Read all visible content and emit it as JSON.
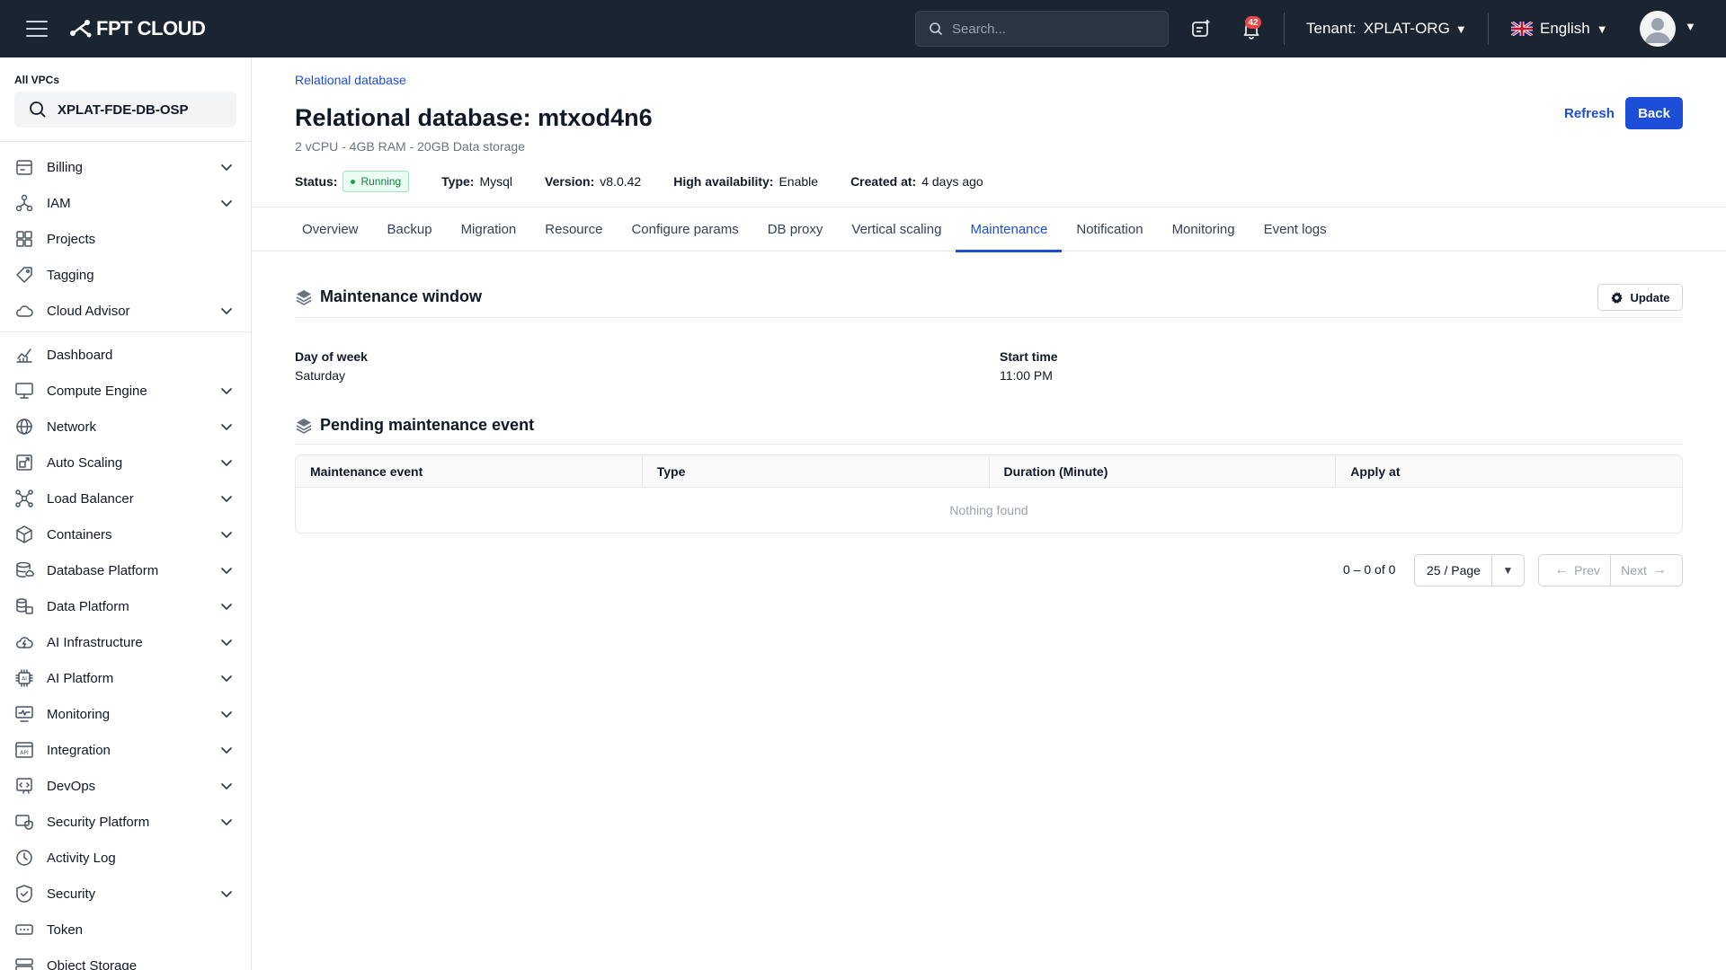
{
  "header": {
    "brand": "FPT CLOUD",
    "search_placeholder": "Search...",
    "notification_count": "42",
    "tenant_label": "Tenant:",
    "tenant_value": "XPLAT-ORG",
    "language": "English"
  },
  "sidebar": {
    "vpc_label": "All VPCs",
    "vpc_value": "XPLAT-FDE-DB-OSP",
    "items": [
      {
        "label": "Billing",
        "icon": "billing-icon",
        "expandable": true
      },
      {
        "label": "IAM",
        "icon": "iam-icon",
        "expandable": true
      },
      {
        "label": "Projects",
        "icon": "projects-icon",
        "expandable": false
      },
      {
        "label": "Tagging",
        "icon": "tag-icon",
        "expandable": false
      },
      {
        "label": "Cloud Advisor",
        "icon": "cloud-icon",
        "expandable": true
      },
      {
        "label": "Dashboard",
        "icon": "dashboard-icon",
        "expandable": false
      },
      {
        "label": "Compute Engine",
        "icon": "monitor-icon",
        "expandable": true
      },
      {
        "label": "Network",
        "icon": "globe-icon",
        "expandable": true
      },
      {
        "label": "Auto Scaling",
        "icon": "scaling-icon",
        "expandable": true
      },
      {
        "label": "Load Balancer",
        "icon": "load-balancer-icon",
        "expandable": true
      },
      {
        "label": "Containers",
        "icon": "box-icon",
        "expandable": true
      },
      {
        "label": "Database Platform",
        "icon": "database-icon",
        "expandable": true
      },
      {
        "label": "Data Platform",
        "icon": "data-platform-icon",
        "expandable": true
      },
      {
        "label": "AI Infrastructure",
        "icon": "ai-infra-icon",
        "expandable": true
      },
      {
        "label": "AI Platform",
        "icon": "ai-chip-icon",
        "expandable": true
      },
      {
        "label": "Monitoring",
        "icon": "monitoring-icon",
        "expandable": true
      },
      {
        "label": "Integration",
        "icon": "api-icon",
        "expandable": true
      },
      {
        "label": "DevOps",
        "icon": "devops-icon",
        "expandable": true
      },
      {
        "label": "Security Platform",
        "icon": "security-platform-icon",
        "expandable": true
      },
      {
        "label": "Activity Log",
        "icon": "clock-icon",
        "expandable": false
      },
      {
        "label": "Security",
        "icon": "shield-icon",
        "expandable": true
      },
      {
        "label": "Token",
        "icon": "token-icon",
        "expandable": false
      },
      {
        "label": "Object Storage",
        "icon": "storage-icon",
        "expandable": false
      }
    ]
  },
  "main": {
    "breadcrumb": "Relational database",
    "title": "Relational database: mtxod4n6",
    "subtitle": "2 vCPU - 4GB RAM - 20GB Data storage",
    "refresh_label": "Refresh",
    "back_label": "Back",
    "meta": {
      "status_label": "Status:",
      "status_value": "Running",
      "type_label": "Type:",
      "type_value": "Mysql",
      "version_label": "Version:",
      "version_value": "v8.0.42",
      "ha_label": "High availability:",
      "ha_value": "Enable",
      "created_label": "Created at:",
      "created_value": "4 days ago"
    },
    "tabs": [
      "Overview",
      "Backup",
      "Migration",
      "Resource",
      "Configure params",
      "DB proxy",
      "Vertical scaling",
      "Maintenance",
      "Notification",
      "Monitoring",
      "Event logs"
    ],
    "active_tab": "Maintenance",
    "maintenance_window": {
      "title": "Maintenance window",
      "update_label": "Update",
      "day_label": "Day of week",
      "day_value": "Saturday",
      "time_label": "Start time",
      "time_value": "11:00 PM"
    },
    "pending": {
      "title": "Pending maintenance event",
      "columns": [
        "Maintenance event",
        "Type",
        "Duration (Minute)",
        "Apply at"
      ],
      "empty_text": "Nothing found"
    },
    "pagination": {
      "count": "0 – 0 of 0",
      "page_size": "25 / Page",
      "prev": "Prev",
      "next": "Next"
    }
  },
  "colors": {
    "topbar": "#1b2431",
    "accent": "#1d4ed8",
    "running": "#15803d",
    "badge": "#ef4444"
  }
}
